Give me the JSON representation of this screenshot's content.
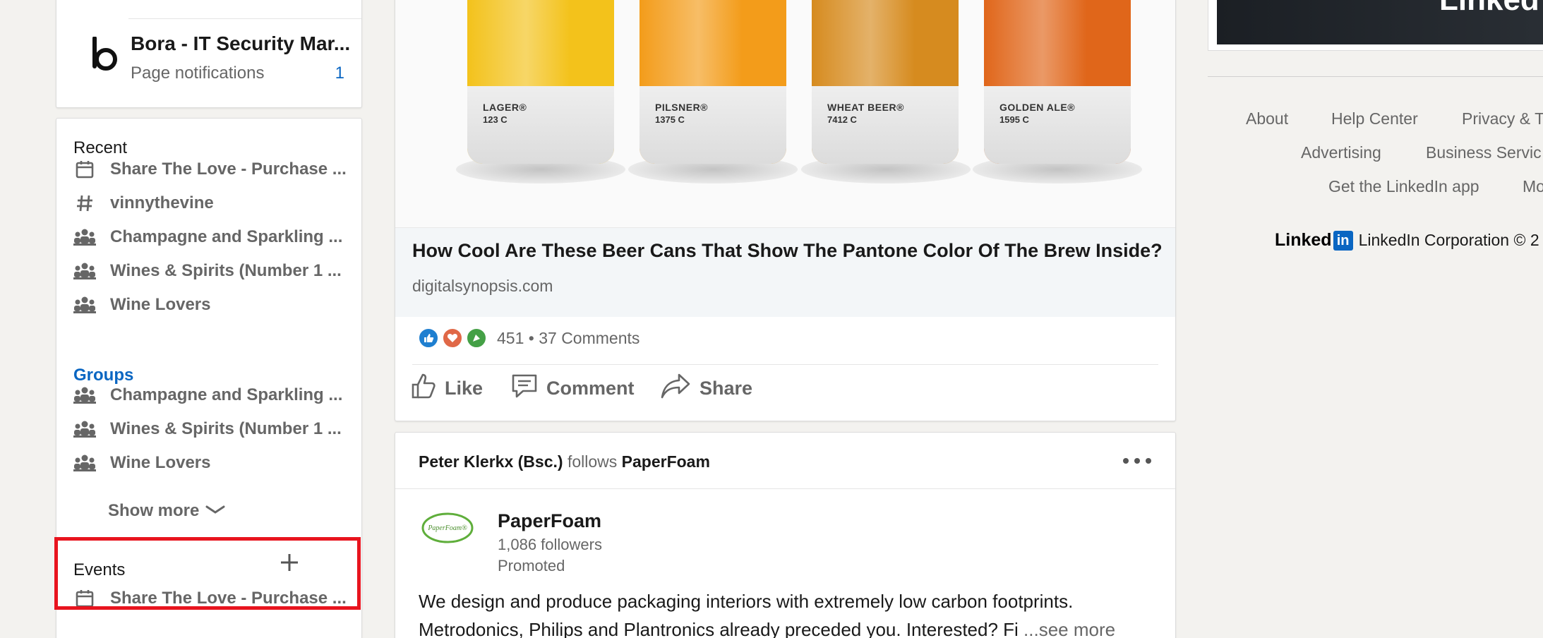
{
  "left": {
    "page_card": {
      "name": "Bora - IT Security Mar...",
      "notifications_label": "Page notifications",
      "notifications_count": "1"
    },
    "recent": {
      "heading": "Recent",
      "items": [
        {
          "icon": "calendar-icon",
          "label": "Share The Love - Purchase ..."
        },
        {
          "icon": "hashtag-icon",
          "label": "vinnythevine"
        },
        {
          "icon": "group-icon",
          "label": "Champagne and Sparkling ..."
        },
        {
          "icon": "group-icon",
          "label": "Wines & Spirits (Number 1 ..."
        },
        {
          "icon": "group-icon",
          "label": "Wine Lovers"
        }
      ]
    },
    "groups": {
      "heading": "Groups",
      "items": [
        {
          "icon": "group-icon",
          "label": "Champagne and Sparkling ..."
        },
        {
          "icon": "group-icon",
          "label": "Wines & Spirits (Number 1 ..."
        },
        {
          "icon": "group-icon",
          "label": "Wine Lovers"
        }
      ],
      "show_more": "Show more"
    },
    "events": {
      "heading": "Events",
      "items": [
        {
          "icon": "calendar-icon",
          "label": "Share The Love - Purchase ..."
        }
      ]
    },
    "highlight_color": "#e8141e"
  },
  "post": {
    "cans": [
      {
        "name": "LAGER®",
        "code": "123 C",
        "color": "#f3c21b"
      },
      {
        "name": "PILSNER®",
        "code": "1375 C",
        "color": "#f39c1a"
      },
      {
        "name": "WHEAT BEER®",
        "code": "7412 C",
        "color": "#d68b1f"
      },
      {
        "name": "GOLDEN ALE®",
        "code": "1595 C",
        "color": "#e0661a"
      }
    ],
    "link_title": "How Cool Are These Beer Cans That Show The Pantone Color Of The Brew Inside?",
    "link_domain": "digitalsynopsis.com",
    "reaction_count": "451",
    "separator": "•",
    "comments": "37 Comments",
    "actions": {
      "like": "Like",
      "comment": "Comment",
      "share": "Share"
    }
  },
  "post2": {
    "actor_name": "Peter Klerkx (Bsc.)",
    "actor_verb": "follows",
    "actor_target": "PaperFoam",
    "company": "PaperFoam",
    "logo_text": "PaperFoam®",
    "followers": "1,086 followers",
    "promoted": "Promoted",
    "body_line1": "We design and produce packaging interiors with extremely low carbon footprints.",
    "body_line2": "Metrodonics, Philips and Plantronics already preceded you. Interested? Fi",
    "see_more": "...see more"
  },
  "right": {
    "ad_brand": "Linked",
    "footer_links": {
      "about": "About",
      "help": "Help Center",
      "privacy": "Privacy & T",
      "advertising": "Advertising",
      "business": "Business Servic",
      "app": "Get the LinkedIn app",
      "more": "Mo"
    },
    "wordmark": "Linked",
    "wordmark_in": "in",
    "corp": "LinkedIn Corporation © 2"
  },
  "colors": {
    "accent": "#0a66c2",
    "background": "#f3f2ef"
  }
}
